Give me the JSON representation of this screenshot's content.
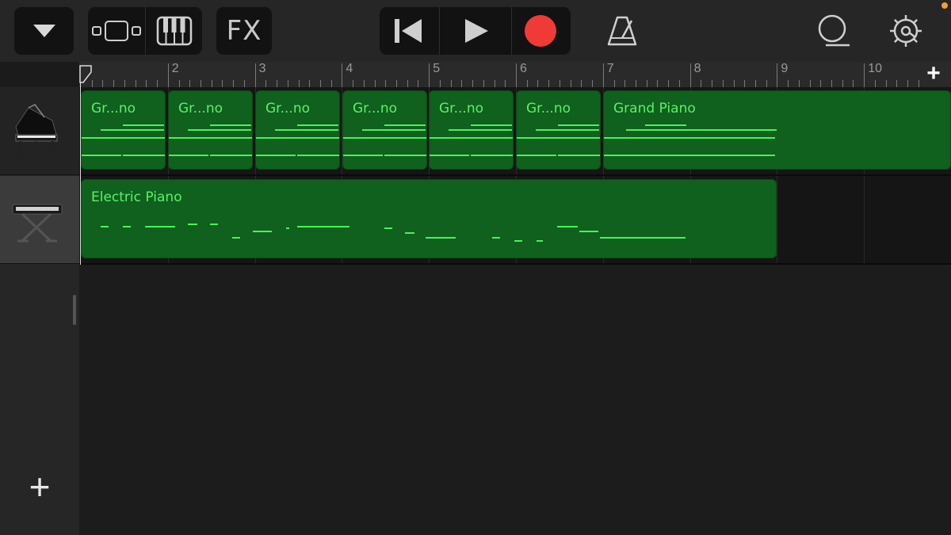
{
  "toolbar": {
    "fx_label": "FX",
    "icons": [
      "browser-dropdown-icon",
      "tracks-view-icon",
      "keyboard-icon",
      "fx-button",
      "go-to-beginning-icon",
      "play-icon",
      "record-icon",
      "metronome-icon",
      "loop-icon",
      "settings-gear-icon"
    ],
    "record_color": "#f03a36",
    "accent_color": "#4cf05a"
  },
  "ruler": {
    "bars": [
      "2",
      "3",
      "4",
      "5",
      "6",
      "7",
      "8",
      "9",
      "10"
    ],
    "add_label": "+"
  },
  "tracks": [
    {
      "instrument": "Grand Piano",
      "icon": "grand-piano-icon",
      "regions": [
        {
          "label": "Gr...no"
        },
        {
          "label": "Gr...no"
        },
        {
          "label": "Gr...no"
        },
        {
          "label": "Gr...no"
        },
        {
          "label": "Gr...no"
        },
        {
          "label": "Gr...no"
        },
        {
          "label": "Grand Piano"
        }
      ]
    },
    {
      "instrument": "Electric Piano",
      "icon": "electric-piano-keyboard-icon",
      "regions": [
        {
          "label": "Electric Piano"
        }
      ]
    }
  ],
  "sidebar": {
    "add_track_label": "+"
  }
}
